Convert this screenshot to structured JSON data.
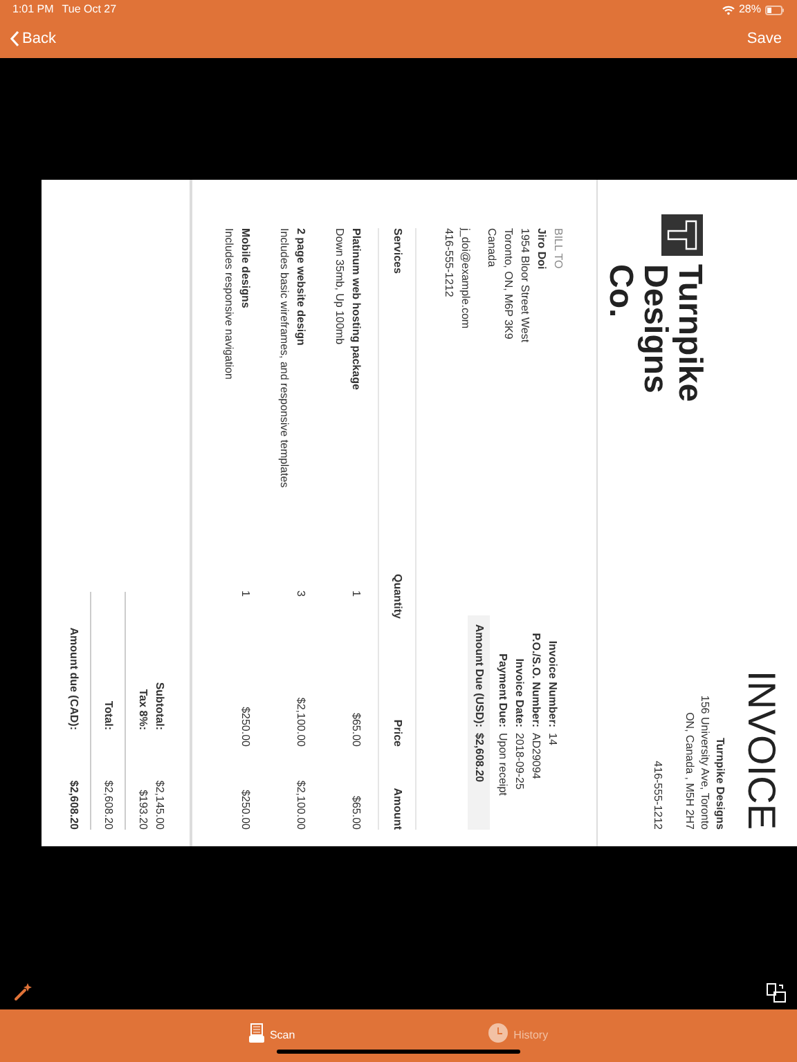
{
  "status_bar": {
    "time": "1:01 PM",
    "date": "Tue Oct 27",
    "battery": "28%"
  },
  "nav_bar": {
    "back": "Back",
    "action": "Save"
  },
  "document": {
    "title": "INVOICE",
    "logo_text": "Turnpike Designs Co.",
    "company": {
      "name": "Turnpike Designs",
      "address_lines": [
        "156 University Ave, Toronto",
        "ON, Canada , M5H 2H7"
      ],
      "phone": "416-555-1212"
    },
    "bill_to": {
      "heading": "BILL TO",
      "name": "Jiro Doi",
      "address_lines": [
        "1954 Bloor Street West",
        "Toronto, ON, M6P 3K9",
        "Canada"
      ],
      "email": "j_doi@example.com",
      "phone": "416-555-1212"
    },
    "details": [
      {
        "label": "Invoice Number:",
        "value": "14"
      },
      {
        "label": "P.O./S.O. Number:",
        "value": "AD29094"
      },
      {
        "label": "Invoice Date:",
        "value": "2018-09-25"
      },
      {
        "label": "Payment Due:",
        "value": "Upon receipt"
      }
    ],
    "amount_due": {
      "label": "Amount Due (USD):",
      "value": "$2,608.20"
    },
    "table": {
      "columns": [
        "Services",
        "Quantity",
        "Price",
        "Amount"
      ],
      "rows": [
        {
          "name": "Platinum web hosting package",
          "description": "Down 35mb, Up 100mb",
          "quantity": "1",
          "price": "$65.00",
          "amount": "$65.00"
        },
        {
          "name": "2 page website design",
          "description": "Includes basic wireframes, and responsive templates",
          "quantity": "3",
          "price": "$2,100.00",
          "amount": "$2,100.00"
        },
        {
          "name": "Mobile designs",
          "description": "Includes responsive navigation",
          "quantity": "1",
          "price": "$250.00",
          "amount": "$250.00"
        }
      ]
    },
    "totals": [
      {
        "kind": "line",
        "label": "Subtotal:",
        "value": "$2,145.00"
      },
      {
        "kind": "line",
        "label": "Tax 8%:",
        "value": "$193.20"
      },
      {
        "kind": "total",
        "label": "Total:",
        "value": "$2,608.20"
      },
      {
        "kind": "grand",
        "label": "Amount due (CAD):",
        "value": "$2,608.20"
      }
    ]
  },
  "tabs": [
    {
      "label": "Scan",
      "selected": true
    },
    {
      "label": "History",
      "selected": false
    }
  ]
}
